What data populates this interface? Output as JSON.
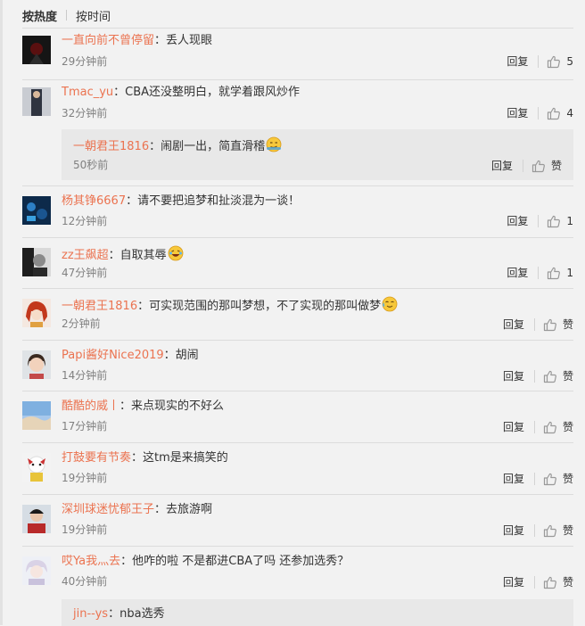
{
  "tabs": {
    "hot": "按热度",
    "time": "按时间"
  },
  "colors": {
    "username": "#eb7350",
    "time": "#808080",
    "background": "#f2f2f2"
  },
  "comments": [
    {
      "user": "一直向前不曾停留",
      "text": "丢人现眼",
      "time": "29分钟前",
      "reply": "回复",
      "like": "5"
    },
    {
      "user": "Tmac_yu",
      "text": "CBA还没整明白，就学着跟风炒作",
      "time": "32分钟前",
      "reply": "回复",
      "like": "4"
    },
    {
      "user": "杨其铮6667",
      "text": "请不要把追梦和扯淡混为一谈！",
      "time": "12分钟前",
      "reply": "回复",
      "like": "1"
    },
    {
      "user": "zz王飙超",
      "text": "自取其辱",
      "time": "47分钟前",
      "reply": "回复",
      "like": "1",
      "emoji": "laugh-emoji"
    },
    {
      "user": "一朝君王1816",
      "text": "可实现范围的那叫梦想，不了实现的那叫做梦",
      "time": "2分钟前",
      "reply": "回复",
      "like": "赞",
      "emoji": "cry-laugh-emoji"
    },
    {
      "user": "Papi酱好Nice2019",
      "text": "胡闹",
      "time": "14分钟前",
      "reply": "回复",
      "like": "赞"
    },
    {
      "user": "酷酷的威丨",
      "text": "来点现实的不好么",
      "time": "17分钟前",
      "reply": "回复",
      "like": "赞"
    },
    {
      "user": "打鼓要有节奏",
      "text": "这tm是来搞笑的",
      "time": "19分钟前",
      "reply": "回复",
      "like": "赞"
    },
    {
      "user": "深圳球迷忧郁王子",
      "text": "去旅游啊",
      "time": "19分钟前",
      "reply": "回复",
      "like": "赞"
    },
    {
      "user": "哎Ya我灬去",
      "text": "他咋的啦  不是都进CBA了吗  还参加选秀？",
      "time": "40分钟前",
      "reply": "回复",
      "like": "赞"
    }
  ],
  "subreplies": [
    {
      "user": "一朝君王1816",
      "text": "闹剧一出，简直滑稽",
      "time": "50秒前",
      "reply": "回复",
      "like": "赞",
      "emoji": "smirk-emoji"
    },
    {
      "user": "jin--ys",
      "text": "nba选秀"
    }
  ]
}
